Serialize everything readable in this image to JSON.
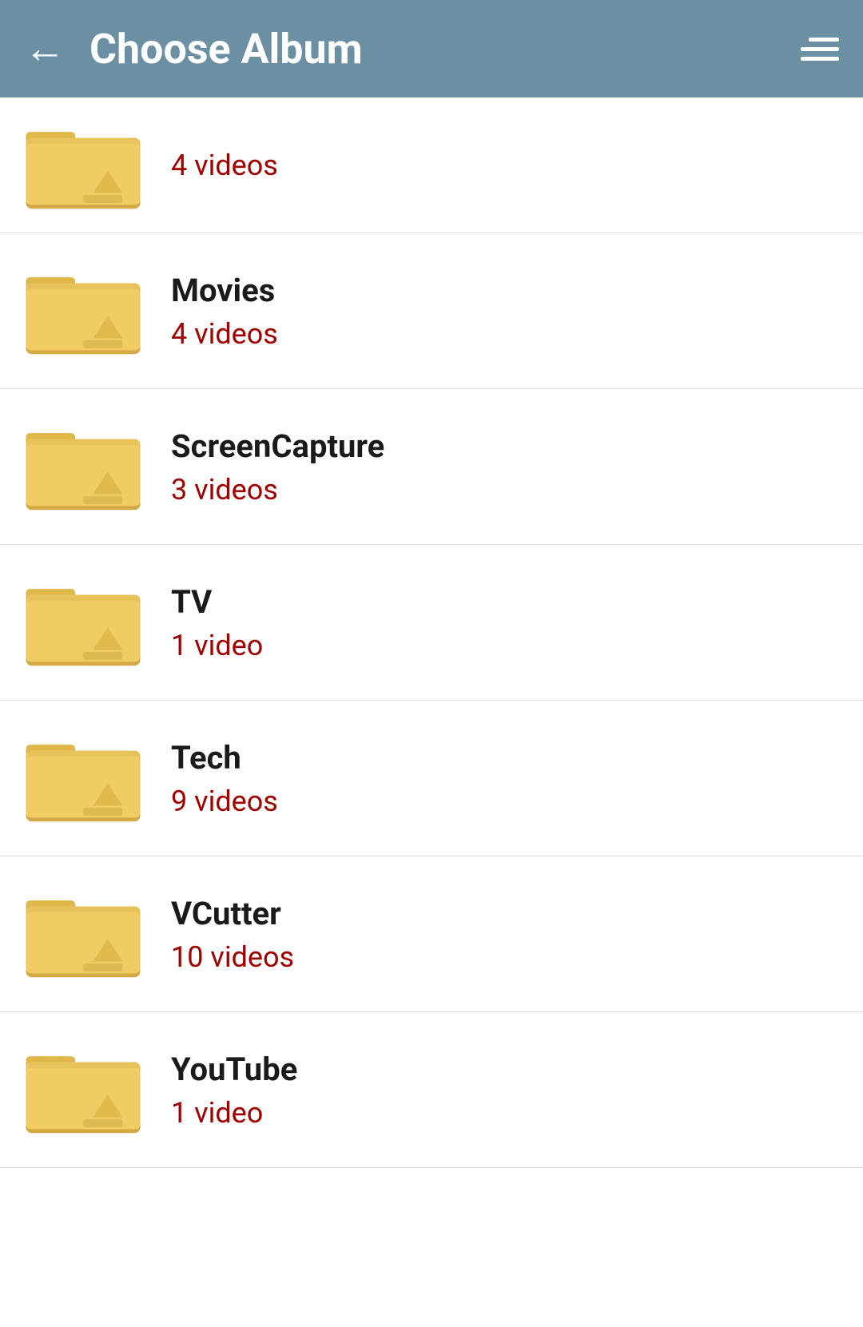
{
  "header": {
    "title": "Choose Album",
    "back_label": "←",
    "colors": {
      "header_bg": "#6b8fa3",
      "header_text": "#ffffff"
    }
  },
  "albums": [
    {
      "id": "album-partial",
      "name": "",
      "count": "4 videos",
      "partial": true
    },
    {
      "id": "album-movies",
      "name": "Movies",
      "count": "4 videos",
      "partial": false
    },
    {
      "id": "album-screencapture",
      "name": "ScreenCapture",
      "count": "3 videos",
      "partial": false
    },
    {
      "id": "album-tv",
      "name": "TV",
      "count": "1 video",
      "partial": false
    },
    {
      "id": "album-tech",
      "name": "Tech",
      "count": "9 videos",
      "partial": false
    },
    {
      "id": "album-vcutter",
      "name": "VCutter",
      "count": "10 videos",
      "partial": false
    },
    {
      "id": "album-youtube",
      "name": "YouTube",
      "count": "1 video",
      "partial": false
    }
  ]
}
